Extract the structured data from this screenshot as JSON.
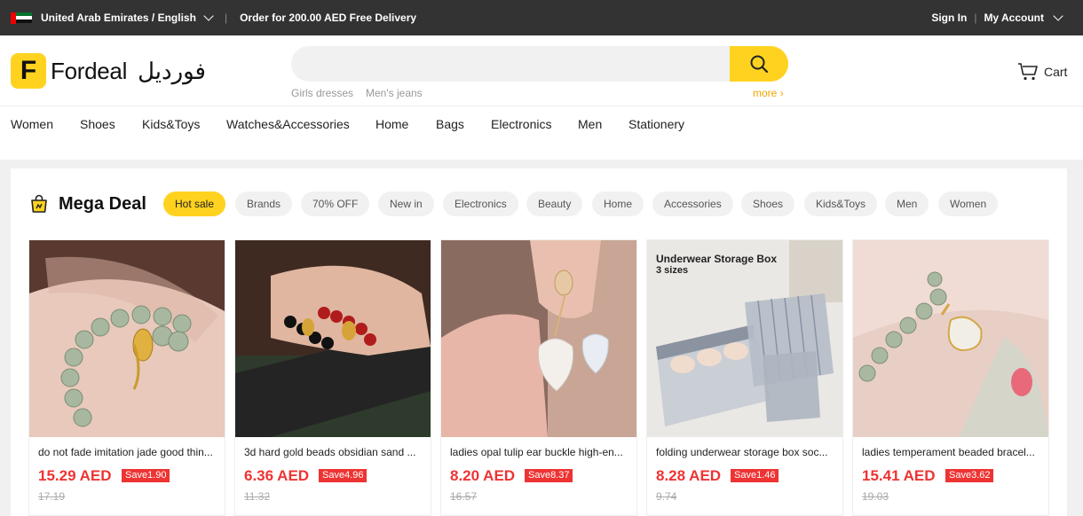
{
  "topbar": {
    "locale": "United Arab Emirates / English",
    "promo": "Order for 200.00 AED Free Delivery",
    "sign_in": "Sign In",
    "separator": "|",
    "my_account": "My Account"
  },
  "header": {
    "logo_letter": "F",
    "logo_text": "Fordeal",
    "logo_arabic": "فورديل",
    "search_placeholder": "",
    "hot_words": [
      "Girls dresses",
      "Men's jeans"
    ],
    "more": "more ›",
    "cart": "Cart"
  },
  "nav": [
    "Women",
    "Shoes",
    "Kids&Toys",
    "Watches&Accessories",
    "Home",
    "Bags",
    "Electronics",
    "Men",
    "Stationery"
  ],
  "mega_deal": {
    "title": "Mega Deal",
    "chips": [
      "Hot sale",
      "Brands",
      "70% OFF",
      "New in",
      "Electronics",
      "Beauty",
      "Home",
      "Accessories",
      "Shoes",
      "Kids&Toys",
      "Men",
      "Women"
    ],
    "active_chip": "Hot sale"
  },
  "products": [
    {
      "title": "do not fade imitation jade good thin...",
      "price": "15.29 AED",
      "save": "Save1.90",
      "old": "17.19"
    },
    {
      "title": "3d hard gold beads obsidian sand ...",
      "price": "6.36 AED",
      "save": "Save4.96",
      "old": "11.32"
    },
    {
      "title": "ladies opal tulip ear buckle high-en...",
      "price": "8.20 AED",
      "save": "Save8.37",
      "old": "16.57"
    },
    {
      "title": "folding underwear storage box soc...",
      "price": "8.28 AED",
      "save": "Save1.46",
      "old": "9.74",
      "image_caption": "Underwear Storage Box",
      "image_subcaption": "3 sizes"
    },
    {
      "title": "ladies temperament beaded bracel...",
      "price": "15.41 AED",
      "save": "Save3.62",
      "old": "19.03"
    }
  ],
  "colors": {
    "accent": "#ffd21f",
    "price": "#e33333",
    "topbar": "#333333"
  }
}
